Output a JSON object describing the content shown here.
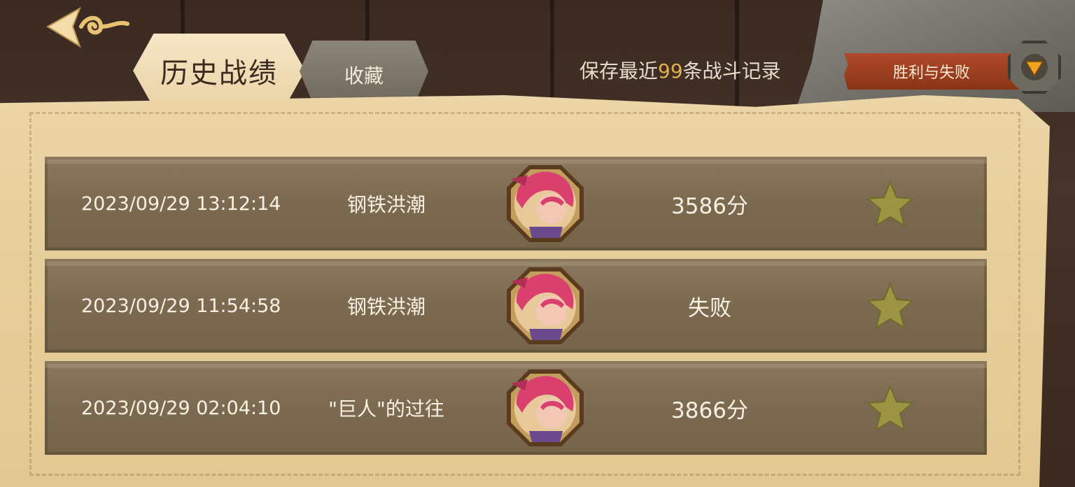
{
  "header": {
    "back_icon": "back-arrow-icon",
    "tabs": [
      {
        "label": "历史战绩",
        "active": true
      },
      {
        "label": "收藏",
        "active": false
      }
    ],
    "save_note_prefix": "保存最近",
    "save_note_count": "99",
    "save_note_suffix": "条战斗记录",
    "filter": {
      "selected": "胜利与失败",
      "icon": "dropdown-triangle-icon"
    }
  },
  "records": [
    {
      "time": "2023/09/29 13:12:14",
      "mode": "钢铁洪潮",
      "result": "3586分",
      "avatar": "hero-portrait",
      "favorite_icon": "star-icon"
    },
    {
      "time": "2023/09/29 11:54:58",
      "mode": "钢铁洪潮",
      "result": "失败",
      "avatar": "hero-portrait",
      "favorite_icon": "star-icon"
    },
    {
      "time": "2023/09/29 02:04:10",
      "mode": "\"巨人\"的过往",
      "result": "3866分",
      "avatar": "hero-portrait",
      "favorite_icon": "star-icon"
    }
  ],
  "colors": {
    "accent_count": "#e2b04a",
    "filter_bg": "#9c3f20",
    "row_bg": "#7f6d53",
    "parchment": "#e9d3a2"
  }
}
